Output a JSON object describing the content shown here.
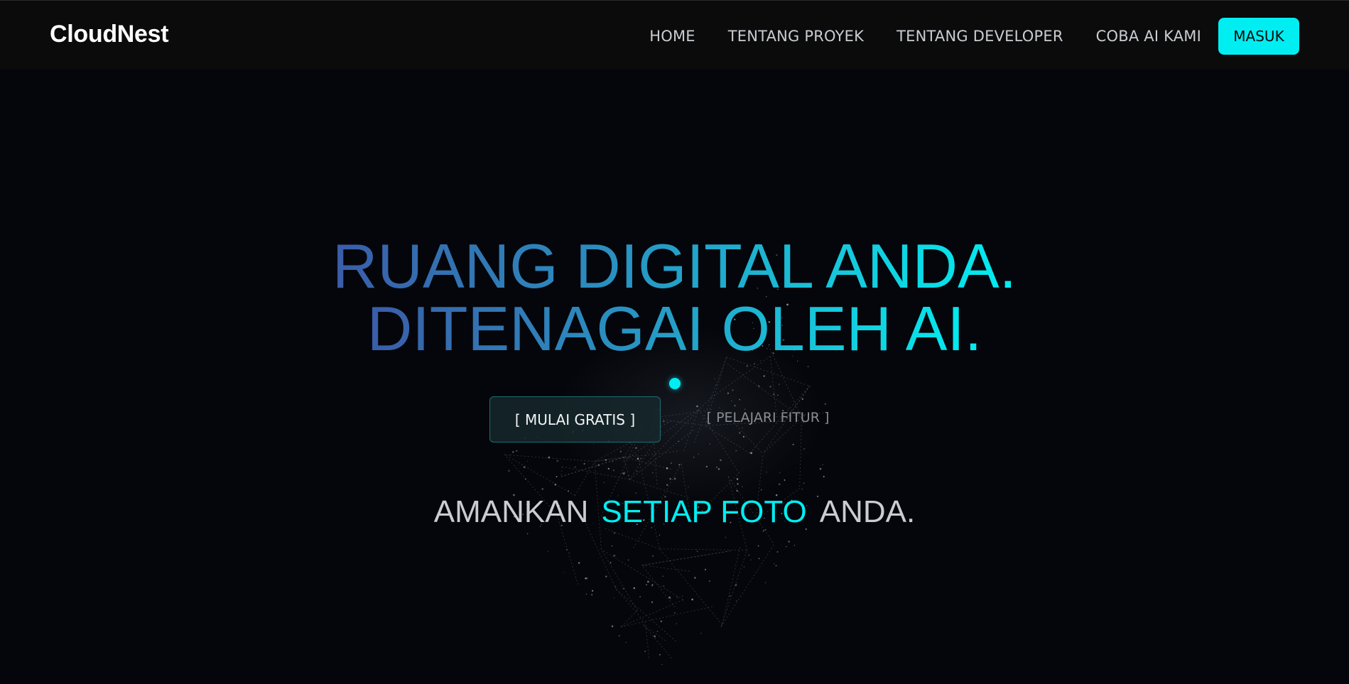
{
  "brand": {
    "name": "CloudNest"
  },
  "nav": {
    "links": [
      "HOME",
      "TENTANG PROYEK",
      "TENTANG DEVELOPER",
      "COBA AI KAMI"
    ],
    "login_label": "MASUK"
  },
  "hero": {
    "headline_line1": "RUANG DIGITAL ANDA.",
    "headline_line2": "DITENAGAI OLEH AI.",
    "primary_cta": "[ MULAI GRATIS ]",
    "secondary_cta": "[ PELAJARI FITUR ]",
    "tagline_prefix": "AMANKAN",
    "tagline_accent": "SETIAP FOTO",
    "tagline_suffix": "ANDA."
  },
  "colors": {
    "accent": "#00eef2",
    "background": "#05060b",
    "navbar": "#0b0b0c",
    "gradient_start": "#3a5ca8",
    "gradient_end": "#00eef2"
  }
}
